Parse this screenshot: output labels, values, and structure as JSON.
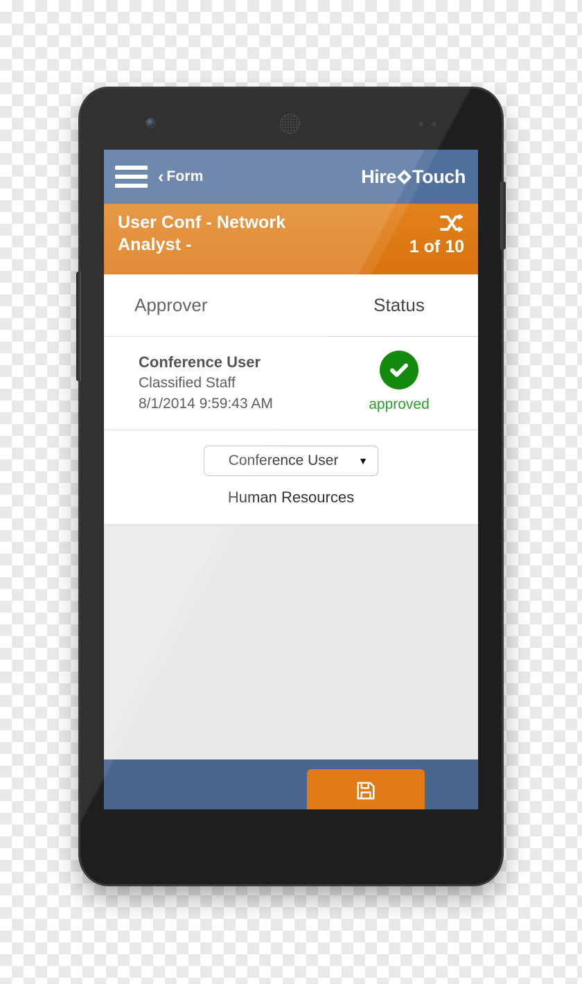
{
  "device": {
    "hardware": {
      "front_camera": "front-camera",
      "earpiece": "earpiece-speaker",
      "power_button": "power-button",
      "volume_rocker": "volume-rocker"
    }
  },
  "appbar": {
    "menu_icon": "hamburger-menu-icon",
    "back_chevron": "‹",
    "back_label": "Form",
    "brand_first": "Hire",
    "brand_second": "Touch",
    "background_color": "#4f6f9c"
  },
  "titlebar": {
    "record_title": "User Conf - Network Analyst -",
    "shuffle_icon": "shuffle-icon",
    "record_counter": "1 of 10",
    "background_color": "#e07b15"
  },
  "table": {
    "columns": {
      "approver": "Approver",
      "status": "Status"
    },
    "rows": [
      {
        "name": "Conference User",
        "role": "Classified Staff",
        "timestamp": "8/1/2014 9:59:43 AM",
        "status_label": "approved",
        "status_icon": "check-circle-icon",
        "status_color": "#128a0c"
      }
    ]
  },
  "assignment": {
    "select_value": "Conference User",
    "select_caret": "▼",
    "department": "Human Resources"
  },
  "bottombar": {
    "save_icon": "save-floppy-icon",
    "background_color": "#49668f",
    "button_color": "#e07b15"
  }
}
